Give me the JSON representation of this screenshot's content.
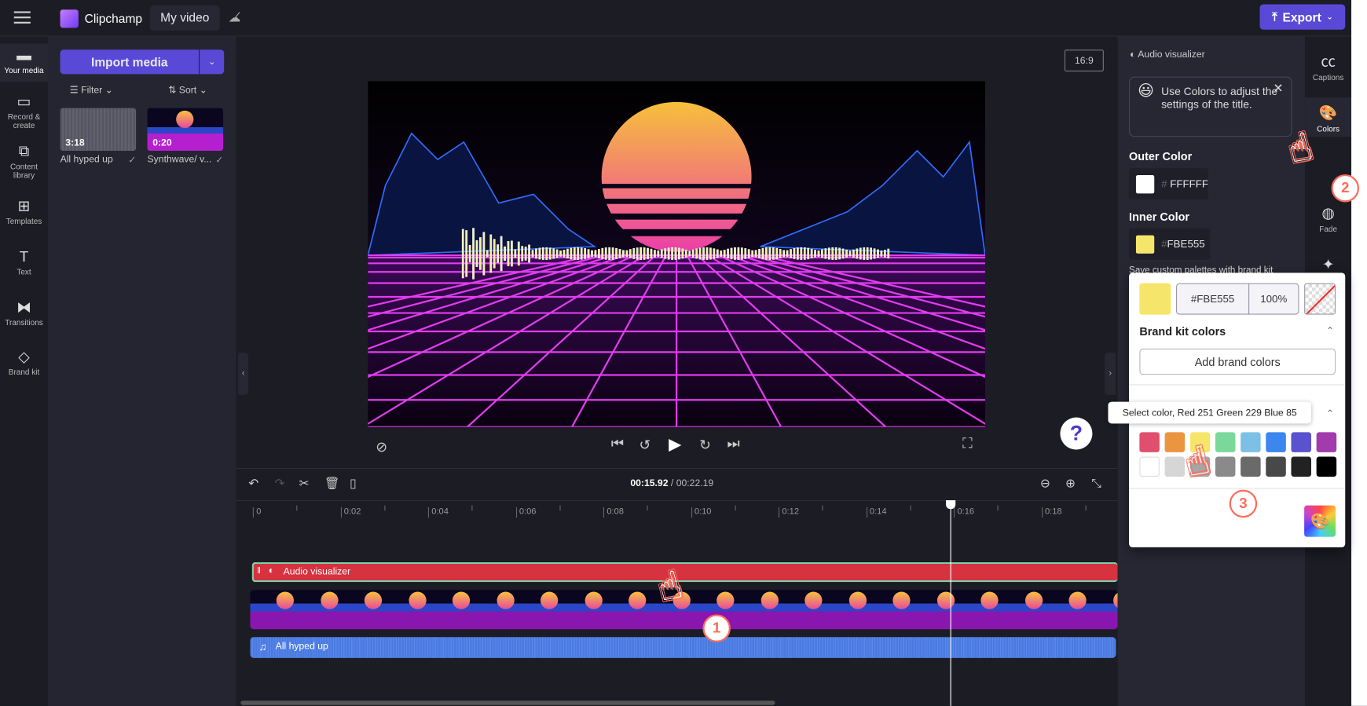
{
  "topbar": {
    "menu_icon": "hamburger-icon",
    "brand": "Clipchamp",
    "project_title": "My video",
    "cloud_icon": "cloud-off-icon",
    "export_label": "Export"
  },
  "rail": {
    "items": [
      {
        "label": "Your media",
        "icon": "folder-icon"
      },
      {
        "label": "Record & create",
        "icon": "camera-icon"
      },
      {
        "label": "Content library",
        "icon": "library-icon"
      },
      {
        "label": "Templates",
        "icon": "templates-icon"
      },
      {
        "label": "Text",
        "icon": "text-icon"
      },
      {
        "label": "Transitions",
        "icon": "transitions-icon"
      },
      {
        "label": "Brand kit",
        "icon": "brand-kit-icon"
      }
    ]
  },
  "media": {
    "import_label": "Import media",
    "filter_label": "Filter",
    "sort_label": "Sort",
    "items": [
      {
        "name": "All hyped up",
        "duration": "3:18"
      },
      {
        "name": "Synthwave/ v...",
        "duration": "0:20"
      }
    ]
  },
  "preview": {
    "aspect_ratio": "16:9",
    "help": "?"
  },
  "timeline": {
    "current_time": "00:15.92",
    "total_time": "/ 00:22.19",
    "ticks": [
      "0",
      "0:02",
      "0:04",
      "0:06",
      "0:08",
      "0:10",
      "0:12",
      "0:14",
      "0:16",
      "0:18"
    ],
    "tracks": {
      "title": "Audio visualizer",
      "audio": "All hyped up"
    },
    "playhead_seconds": 15.92
  },
  "panel": {
    "title": "Audio visualizer",
    "tip": "Use Colors to adjust the settings of the title.",
    "outer_label": "Outer Color",
    "outer_hex": "FFFFFF",
    "inner_label": "Inner Color",
    "inner_hex": "FBE555",
    "brand_note": "Save custom palettes with brand kit"
  },
  "popup": {
    "hex": "#FBE555",
    "opacity": "100%",
    "brand_heading": "Brand kit colors",
    "add_brand": "Add brand colors",
    "tooltip": "Select color, Red 251 Green 229 Blue 85",
    "swatches": [
      "#e0506e",
      "#ec9540",
      "#f6e56b",
      "#7ad89a",
      "#7dc0e6",
      "#3b86ef",
      "#5a52cf",
      "#a23bab",
      "#ffffff",
      "#d6d6d6",
      "#a5a5a5",
      "#8a8a8a",
      "#6a6a6a",
      "#484848",
      "#222222",
      "#000000"
    ]
  },
  "tabs": [
    {
      "label": "Captions",
      "icon": "captions-icon"
    },
    {
      "label": "Colors",
      "icon": "palette-icon"
    },
    {
      "label": "Fade",
      "icon": "fade-icon"
    },
    {
      "label": "",
      "icon": "magic-wand-icon"
    }
  ],
  "steps": [
    "1",
    "2",
    "3"
  ],
  "colors": {
    "accent": "#5a49d6",
    "title_track": "#d6323f",
    "audio_track": "#4a7ae0",
    "inner": "#FBE555"
  }
}
